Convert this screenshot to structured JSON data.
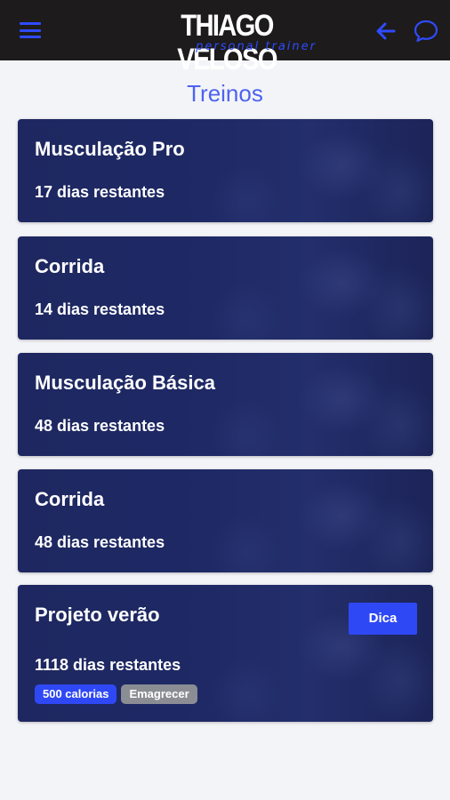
{
  "header": {
    "logo_main": "THIAGO VELOSO",
    "logo_sub": "personal trainer",
    "menu_icon": "menu-icon",
    "back_icon": "arrow-left-icon",
    "chat_icon": "chat-bubble-icon",
    "accent_color": "#2f4bff"
  },
  "page": {
    "title": "Treinos"
  },
  "workouts": [
    {
      "name": "Musculação Pro",
      "remaining": "17 dias restantes"
    },
    {
      "name": "Corrida",
      "remaining": "14 dias restantes"
    },
    {
      "name": "Musculação Básica",
      "remaining": "48 dias restantes"
    },
    {
      "name": "Corrida",
      "remaining": "48 dias restantes"
    },
    {
      "name": "Projeto verão",
      "remaining": "1118 dias restantes",
      "button": "Dica",
      "tags": [
        "500 calorias",
        "Emagrecer"
      ]
    }
  ]
}
